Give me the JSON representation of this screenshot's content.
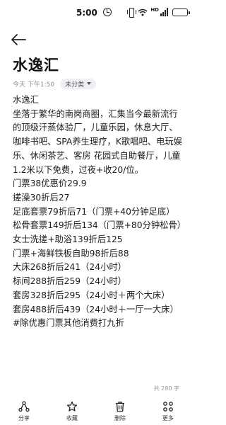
{
  "status_bar": {
    "time": "5:00",
    "signal_label": "HD",
    "battery_level": 1.0,
    "icons": [
      "alarm-icon",
      "vibrate-icon",
      "wifi-icon",
      "signal-icon",
      "battery-icon"
    ]
  },
  "header": {
    "back_icon": "arrow-left-icon"
  },
  "note": {
    "title": "水逸汇",
    "date": "今天 下午1:50",
    "category": "未分类",
    "body": [
      "水逸汇",
      "坐落于繁华的南岗商圈，汇集当今最新流行的顶级汗蒸体验厂，儿童乐园，休息大厅、咖啡书吧、SPA养生理疗，K歌唱吧、电玩娱乐、休闲茶艺、客房 花园式自助餐厅，儿童1.2米以下免费，过夜+收20/位。",
      "门票38优惠价29.9",
      "搓澡30折后27",
      "足底套票79折后71（门票+40分钟足底）",
      "松骨套票149折后134（门票+80分钟松骨）",
      "女士洗搓+助浴139折后125",
      "门票+海鲜铁板自助98折后88",
      "大床268折后241（24小时）",
      "标间288折后259（24小时）",
      "套房328折后295（24小时＋两个大床）",
      "套房488折后439（24小时＋一厅一大床）",
      "#除优惠门票其他消费打九折"
    ],
    "char_count": "共 280 字"
  },
  "toolbar": {
    "share": "分享",
    "favorite": "收藏",
    "delete": "删除",
    "more": "更多"
  },
  "colors": {
    "text": "#1c1c1c",
    "meta": "#8a8a8a",
    "pill_bg": "#eef0f3",
    "background": "#ffffff"
  }
}
